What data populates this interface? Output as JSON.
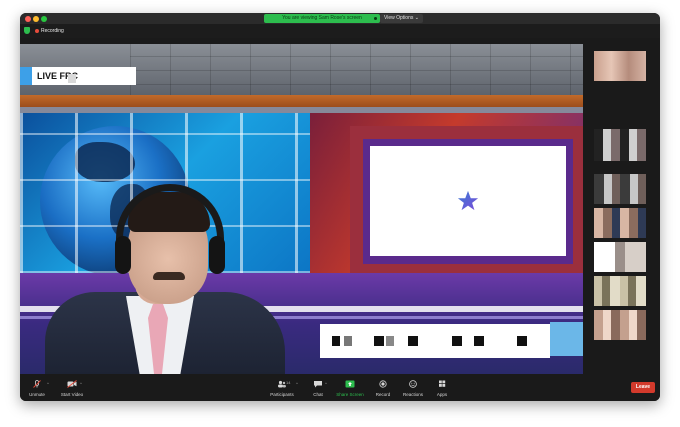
{
  "window": {
    "share_banner": "You are viewing Sam Rose's screen",
    "view_options": "View Options ⌄"
  },
  "recording": {
    "label": "Recording"
  },
  "stage": {
    "live_label": "LIVE FRC"
  },
  "toolbar": {
    "unmute": "Unmute",
    "start_video": "Start Video",
    "participants": "Participants",
    "participants_count": "14",
    "chat": "Chat",
    "share_screen": "Share Screen",
    "record": "Record",
    "reactions": "Reactions",
    "apps": "Apps",
    "leave": "Leave"
  },
  "colors": {
    "share_green": "#2dbd4e",
    "leave_red": "#d33a2c",
    "recording_red": "#e74c3c"
  },
  "icons": {
    "unmute": "muted-microphone-icon",
    "start_video": "video-camera-icon",
    "participants": "participants-icon",
    "chat": "chat-bubble-icon",
    "share_screen": "share-screen-icon",
    "record": "record-icon",
    "reactions": "reactions-icon",
    "apps": "apps-icon"
  }
}
